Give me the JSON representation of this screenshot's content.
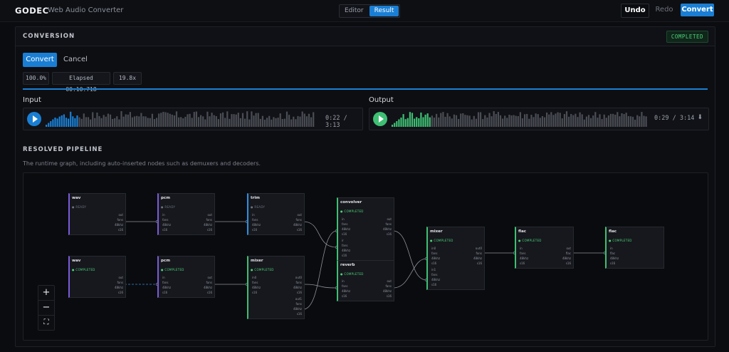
{
  "app": {
    "brand": "GODEC",
    "subtitle": "Web Audio Converter"
  },
  "view_toggle": {
    "editor": "Editor",
    "result": "Result"
  },
  "toolbar": {
    "undo": "Undo",
    "redo": "Redo",
    "convert": "Convert"
  },
  "conversion": {
    "title": "CONVERSION",
    "status": "COMPLETED",
    "convert_label": "Convert",
    "cancel_label": "Cancel",
    "progress": "100.0%",
    "elapsed": "Elapsed 00:10.718",
    "speed": "19.8x",
    "progress_fraction": 1.0
  },
  "input": {
    "label": "Input",
    "time": "0:22",
    "sep": "/",
    "duration": "3:13",
    "played_fraction": 0.115,
    "color": "#1a7fd4"
  },
  "output": {
    "label": "Output",
    "time": "0:29",
    "sep": "/",
    "duration": "3:14",
    "played_fraction": 0.15,
    "color": "#3fbf74",
    "download_icon": "⬇"
  },
  "pipeline": {
    "title": "RESOLVED PIPELINE",
    "description": "The runtime graph, including auto-inserted nodes such as demuxers and decoders.",
    "nodes": {
      "wav1": {
        "title": "wav",
        "status": "READY"
      },
      "pcm1": {
        "title": "pcm",
        "status": "READY"
      },
      "trim": {
        "title": "trim",
        "status": "READY"
      },
      "wav2": {
        "title": "wav",
        "status": "COMPLETED"
      },
      "pcm2": {
        "title": "pcm",
        "status": "COMPLETED"
      },
      "mixer1": {
        "title": "mixer",
        "status": "COMPLETED"
      },
      "convolver": {
        "title": "convolver",
        "status": "COMPLETED"
      },
      "reverb": {
        "title": "reverb",
        "status": "COMPLETED"
      },
      "mixer2": {
        "title": "mixer",
        "status": "COMPLETED"
      },
      "flac1": {
        "title": "flac",
        "status": "COMPLETED"
      },
      "flac2": {
        "title": "flac",
        "status": "COMPLETED"
      }
    },
    "ports": {
      "in": "in",
      "out": "out",
      "fans": "fans",
      "48khz": "48khz",
      "s16": "s16",
      "in0": "in0",
      "in1": "in1",
      "out0": "out0",
      "out1": "out1",
      "ir": "ir",
      "flac": "flac"
    }
  },
  "zoom_controls": {
    "in": "+",
    "out": "−",
    "fit": "⛶"
  }
}
